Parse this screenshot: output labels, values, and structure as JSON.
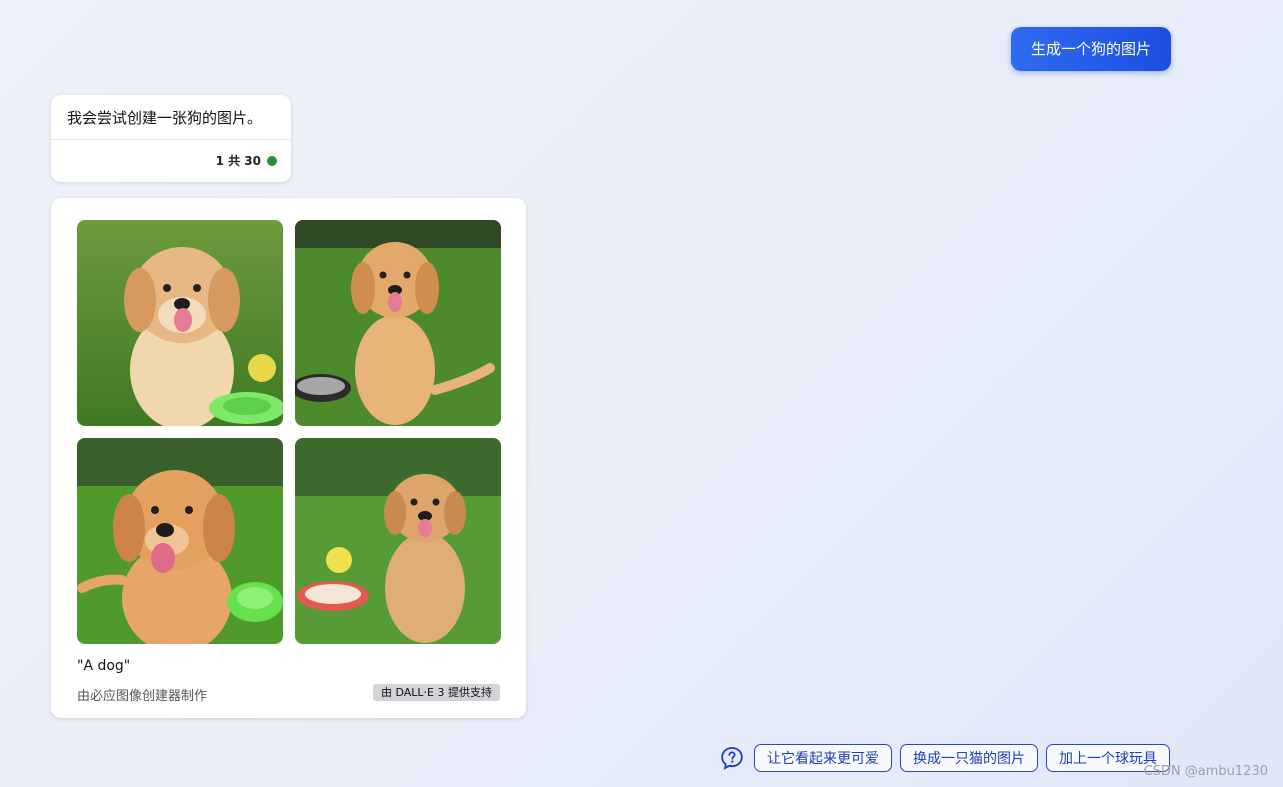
{
  "user_message": "生成一个狗的图片",
  "bot_message": {
    "text": "我会尝试创建一张狗的图片。",
    "counter": "1 共 30",
    "status_color": "#2f8a3c"
  },
  "image_card": {
    "images": [
      {
        "icon": "dog-photo-icon"
      },
      {
        "icon": "dog-photo-icon"
      },
      {
        "icon": "dog-photo-icon"
      },
      {
        "icon": "dog-photo-icon"
      }
    ],
    "prompt_caption": "\"A dog\"",
    "maker_text": "由必应图像创建器制作",
    "powered_badge": "由 DALL·E 3 提供支持"
  },
  "suggestions": {
    "help_icon": "question-bubble-icon",
    "chips": [
      "让它看起来更可爱",
      "换成一只猫的图片",
      "加上一个球玩具"
    ]
  },
  "watermark": "CSDN @ambu1230",
  "colors": {
    "accent": "#1d4fe0",
    "chip_border": "#2b45c9"
  }
}
